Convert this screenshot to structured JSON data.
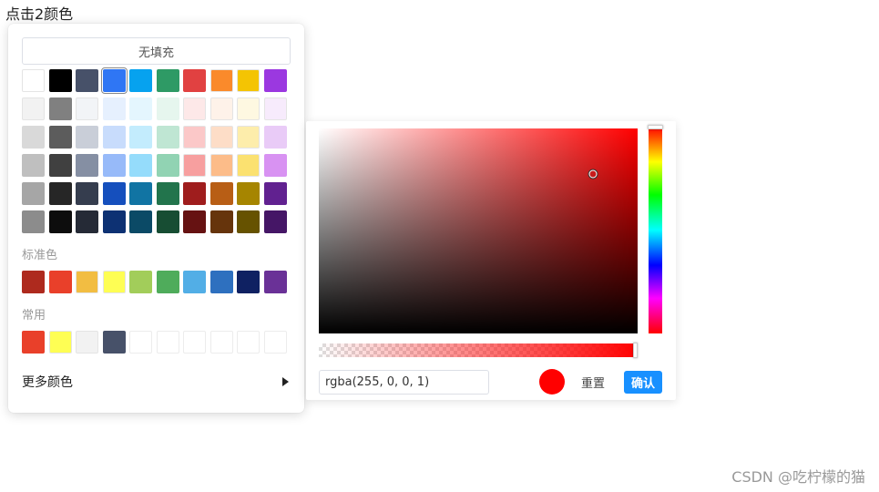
{
  "trigger": {
    "label": "点击2颜色"
  },
  "palette": {
    "no_fill_label": "无填充",
    "main_colors": [
      [
        "#ffffff",
        "#000000",
        "#475169",
        "#2f76f4",
        "#06a2ef",
        "#2e9a65",
        "#e14141",
        "#fa8a2b",
        "#f4c403",
        "#9b38e0"
      ],
      [
        "#f2f2f2",
        "#808080",
        "#f2f4f7",
        "#e6f0fe",
        "#e4f6fe",
        "#e6f6ee",
        "#fde8e8",
        "#fef2e9",
        "#fef8e1",
        "#f7ebfc"
      ],
      [
        "#d9d9d9",
        "#5c5c5c",
        "#c9ced8",
        "#c8dcfc",
        "#c3ecfd",
        "#bfe6d3",
        "#fbc8c8",
        "#fdddc7",
        "#fdedab",
        "#e9cbf7"
      ],
      [
        "#bfbfbf",
        "#404040",
        "#858fa3",
        "#97baf9",
        "#95dcfb",
        "#91d3b3",
        "#f79f9f",
        "#fcbc89",
        "#fbe170",
        "#d892f2"
      ],
      [
        "#a6a6a6",
        "#262626",
        "#353d4e",
        "#154fbd",
        "#1174a3",
        "#22744c",
        "#9f1d1d",
        "#b85e15",
        "#a68500",
        "#612190"
      ],
      [
        "#8c8c8c",
        "#0d0d0d",
        "#252a36",
        "#0d3173",
        "#0b4a66",
        "#174d33",
        "#661212",
        "#66340c",
        "#665200",
        "#451666"
      ]
    ],
    "selected_color": "#2f76f4",
    "standard_label": "标准色",
    "standard_colors": [
      "#ae2a1e",
      "#e9402a",
      "#f2bd42",
      "#fefe54",
      "#a2cd5a",
      "#4fac5b",
      "#52aee6",
      "#2e70bf",
      "#0f2162",
      "#6a3197"
    ],
    "recent_label": "常用",
    "recent_colors": [
      "#e9402a",
      "#fefe54",
      "#f2f2f2",
      "#475169"
    ],
    "recent_empty_slots": 6,
    "more_colors_label": "更多颜色",
    "more_icon": "caret-right-icon"
  },
  "picker": {
    "hue_color": "#ff0000",
    "saturation": 0.86,
    "brightness": 0.78,
    "hue": 0,
    "alpha": 1,
    "value": "rgba(255, 0, 0, 1)",
    "preview_color": "#ff0000",
    "reset_label": "重置",
    "confirm_label": "确认",
    "confirm_color": "#1890ff"
  },
  "watermark": {
    "text": "CSDN @吃柠檬的猫"
  }
}
